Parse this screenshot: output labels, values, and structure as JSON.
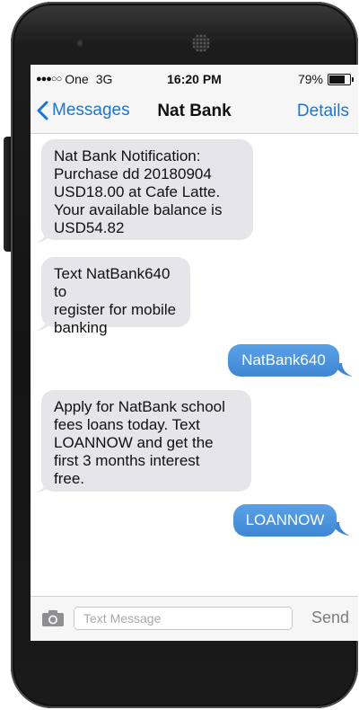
{
  "status_bar": {
    "signal": "●●●○○",
    "carrier": "One",
    "network": "3G",
    "time": "16:20 PM",
    "battery_label": "79%",
    "battery_level": 0.79
  },
  "nav": {
    "back_label": "Messages",
    "title": "Nat Bank",
    "details_label": "Details"
  },
  "messages": [
    {
      "direction": "received",
      "text": "Nat Bank Notification:\nPurchase dd 20180904\nUSD18.00 at Cafe Latte.\nYour available balance is\nUSD54.82"
    },
    {
      "direction": "received",
      "text": "Text NatBank640 to\nregister for mobile\nbanking"
    },
    {
      "direction": "sent",
      "text": "NatBank640"
    },
    {
      "direction": "received",
      "text": "Apply for NatBank school\nfees loans today. Text\nLOANNOW and get the\nfirst 3 months interest\nfree."
    },
    {
      "direction": "sent",
      "text": "LOANNOW"
    }
  ],
  "composer": {
    "placeholder": "Text Message",
    "value": "",
    "send_label": "Send"
  },
  "colors": {
    "accent": "#1a76d2",
    "sent_bubble": "#4a90d9",
    "received_bubble": "#e5e5ea",
    "bar_background": "#f6f6f7"
  },
  "icons": {
    "back": "chevron-left-icon",
    "camera": "camera-icon",
    "battery": "battery-icon"
  }
}
